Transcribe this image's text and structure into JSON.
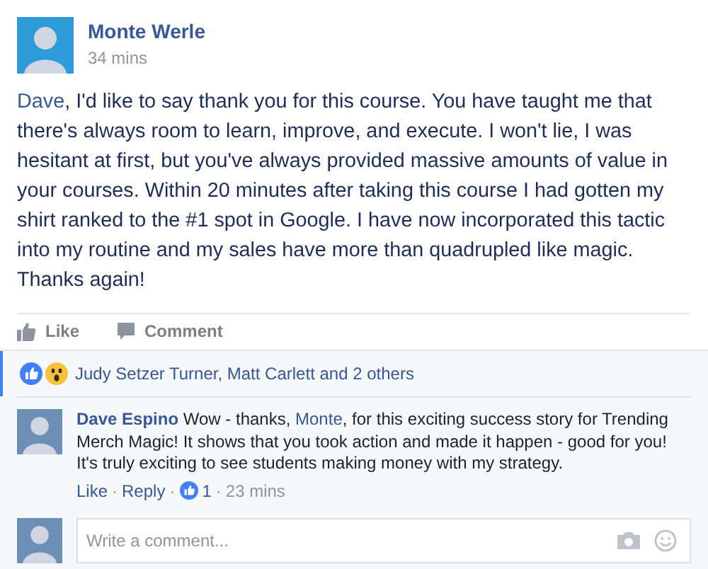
{
  "post": {
    "author": "Monte Werle",
    "time": "34 mins",
    "body": [
      {
        "kind": "mention",
        "text": "Dave"
      },
      {
        "kind": "text",
        "text": ", I'd like to say thank you for this course. You have taught me that there's always room to learn, improve, and execute. I won't lie, I was hesitant at first, but you've always provided massive amounts of value in your courses. Within 20 minutes after taking this course I had gotten my shirt ranked to the #1 spot in Google. I have now incorporated this tactic into my routine and my sales have more than quadrupled like magic. Thanks again!"
      }
    ],
    "actions": [
      "Like",
      "Comment"
    ]
  },
  "reactions": {
    "text": "Judy Setzer Turner, Matt Carlett and 2 others"
  },
  "comments": [
    {
      "author": "Dave Espino",
      "body": [
        {
          "kind": "text",
          "text": "Wow - thanks, "
        },
        {
          "kind": "mention",
          "text": "Monte"
        },
        {
          "kind": "text",
          "text": ", for this exciting success story for Trending Merch Magic! It shows that you took action and made it happen - good for you! It's truly exciting to see students making money with my strategy."
        }
      ],
      "actions": [
        "Like",
        "Reply"
      ],
      "separator": "·",
      "like_count": "1",
      "time": "23 mins"
    }
  ],
  "composer": {
    "placeholder": "Write a comment..."
  }
}
